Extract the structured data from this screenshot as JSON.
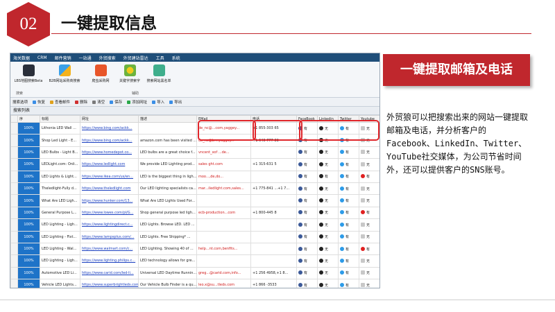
{
  "slide": {
    "number": "02",
    "title": "一键提取信息",
    "banner": "一键提取邮箱及电话",
    "description": "外贸狼可以把搜索出来的网站一键提取邮箱及电话，并分析客户的Facebook、LinkedIn、Twitter、YouTube社交媒体，为公司节省时间外，还可以提供客户的SNS账号。"
  },
  "colors": {
    "brand_red": "#c0272d",
    "menubar": "#1f4e79",
    "progress": "#1e73c8"
  },
  "app": {
    "menu": [
      "海关数据",
      "CRM",
      "邮件营销",
      "一站通",
      "外贸搜索",
      "外贸建站雷达",
      "工具",
      "系统"
    ],
    "ribbon_buttons": [
      {
        "label": "LBS地图搜索Beta",
        "icon": "map-pin-icon"
      },
      {
        "label": "B2B网站采购商搜索",
        "icon": "chat-bubbles-icon"
      },
      {
        "label": "爬虫采购网",
        "icon": "search-icon"
      },
      {
        "label": "关键字搜索字",
        "icon": "target-icon"
      },
      {
        "label": "搜索网站黑名单",
        "icon": "list-icon"
      }
    ],
    "ribbon_groups": [
      "搜索",
      "辅助"
    ],
    "toolbar": [
      "搜索选项",
      "恢复",
      "查看邮件",
      "删除",
      "清空",
      "保存",
      "添加网址",
      "导入",
      "导出"
    ],
    "list_title": "搜索列表",
    "columns": [
      "序",
      "标题",
      "网址",
      "描述",
      "EMail",
      "电话",
      "FaceBook",
      "Linkedin",
      "Twitter",
      "Youtube"
    ],
    "rows": [
      {
        "progress": "100%",
        "title": "Lithonia LED Wall ...",
        "url": "https://www.bing.com/ackk...",
        "desc": "",
        "email": "de_nc@...com,yaggey...",
        "phone": "+1 855-303  65",
        "fb": "有",
        "li": "无",
        "tw": "有",
        "yt": "无",
        "yt_on": false
      },
      {
        "progress": "100%",
        "title": "Shop Led Light - E...",
        "url": "https://www.bing.com/ackk...",
        "desc": "amazon.com has been visited ...",
        "email": "de_nc@b...,yaggey...",
        "phone": "+1 640-777  83",
        "fb": "有",
        "li": "无",
        "tw": "有",
        "yt": "无",
        "yt_on": false
      },
      {
        "progress": "100%",
        "title": "LED Bulbs - Light B...",
        "url": "https://www.homedepot.co...",
        "desc": "LED bulbs are a great choice f...",
        "email": "vncent_xof   ...de...",
        "phone": "",
        "fb": "有",
        "li": "无",
        "tw": "有",
        "yt": "无",
        "yt_on": false
      },
      {
        "progress": "100%",
        "title": "LEDLight.com: Onli...",
        "url": "https://www.ledlight.com",
        "desc": "We provide LED Lighting prod...",
        "email": "sales   ght.com",
        "phone": "+1 315-631  5",
        "fb": "有",
        "li": "无",
        "tw": "有",
        "yt": "无",
        "yt_on": false
      },
      {
        "progress": "100%",
        "title": "LED Lights & Light...",
        "url": "https://www.ikea.com/us/en...",
        "desc": "LED is the biggest thing in ligh...",
        "email": "moo...,de,do...",
        "phone": "",
        "fb": "有",
        "li": "有",
        "tw": "有",
        "yt": "有",
        "yt_on": true
      },
      {
        "progress": "100%",
        "title": "Theledlight-Fully d...",
        "url": "https://www.theledlight.com",
        "desc": "Our LED lighting specialists ca...",
        "email": "mar...iledlight.com,sales...",
        "phone": "+1 775-841  ...+1 7...",
        "fb": "有",
        "li": "无",
        "tw": "有",
        "yt": "无",
        "yt_on": false
      },
      {
        "progress": "100%",
        "title": "What Are LED Ligh...",
        "url": "https://www.hunker.com/13...",
        "desc": "What Are LED Lights Used For...",
        "email": "",
        "phone": "",
        "fb": "有",
        "li": "无",
        "tw": "有",
        "yt": "无",
        "yt_on": false
      },
      {
        "progress": "100%",
        "title": "General Purpose L...",
        "url": "https://www.lowes.com/pl/G...",
        "desc": "Shop general purpose led ligh...",
        "email": "ecb-production...com",
        "phone": "+1 800-445  8",
        "fb": "有",
        "li": "无",
        "tw": "有",
        "yt": "有",
        "yt_on": true
      },
      {
        "progress": "100%",
        "title": "LED Lighting - Ligh...",
        "url": "https://www.lightingdirect.c...",
        "desc": "LED Lights. Browse LED. LED ...",
        "email": "",
        "phone": "",
        "fb": "有",
        "li": "无",
        "tw": "有",
        "yt": "无",
        "yt_on": false
      },
      {
        "progress": "100%",
        "title": "LED Lighting - Fixt...",
        "url": "https://www.lampsplus.com/...",
        "desc": "LED Lights. Free Shipping* ...",
        "email": "",
        "phone": "",
        "fb": "有",
        "li": "无",
        "tw": "有",
        "yt": "无",
        "yt_on": false
      },
      {
        "progress": "100%",
        "title": "LED Lighting - Wal...",
        "url": "https://www.walmart.com/c...",
        "desc": "LED Lighting. Showing 40 of ...",
        "email": "help...nt.com,benfits...",
        "phone": "",
        "fb": "有",
        "li": "无",
        "tw": "有",
        "yt": "有",
        "yt_on": true
      },
      {
        "progress": "100%",
        "title": "LED Lighting - Ligh...",
        "url": "https://www.lighting.philips.c...",
        "desc": "LED technology allows for gre...",
        "email": "",
        "phone": "",
        "fb": "有",
        "li": "无",
        "tw": "有",
        "yt": "无",
        "yt_on": false
      },
      {
        "progress": "100%",
        "title": "Automotive LED Li...",
        "url": "https://www.carid.com/led-li...",
        "desc": "Universal LED Daytime Runnin...",
        "email": "greg...@carid.com,info...",
        "phone": "+1 256  4958,+1 8...",
        "fb": "有",
        "li": "无",
        "tw": "有",
        "yt": "无",
        "yt_on": false
      },
      {
        "progress": "100%",
        "title": "Vehicle LED Lights...",
        "url": "https://www.superbrightleds.com",
        "desc": "Our Vehicle Bulb Finder is a qu...",
        "email": "leo.x@su...tleds.com",
        "phone": "+1 866  -3533",
        "fb": "有",
        "li": "无",
        "tw": "有",
        "yt": "无",
        "yt_on": false
      }
    ]
  }
}
